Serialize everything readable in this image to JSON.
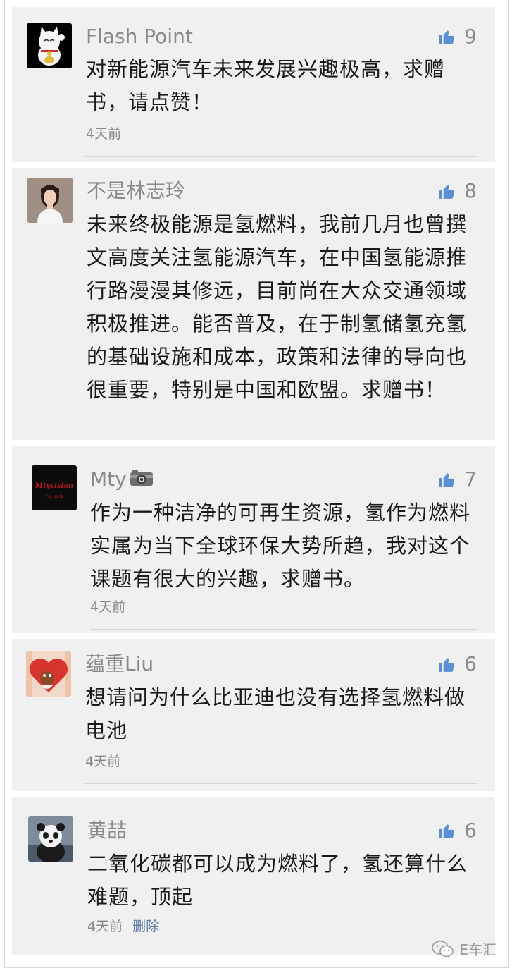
{
  "comments": [
    {
      "name": "Flash Point",
      "likes": "9",
      "content": "对新能源汽车未来发展兴趣极高，求赠书，请点赞！",
      "time": "4天前",
      "avatar_icon": "lucky-cat-avatar"
    },
    {
      "name": "不是林志玲",
      "likes": "8",
      "content": "未来终极能源是氢燃料，我前几月也曾撰文高度关注氢能源汽车，在中国氢能源推行路漫漫其修远，目前尚在大众交通领域积极推进。能否普及，在于制氢储氢充氢的基础设施和成本，政策和法律的导向也很重要，特别是中国和欧盟。求赠书！",
      "avatar_icon": "woman-portrait-avatar"
    },
    {
      "name": "Mty",
      "name_icon": "camera-icon",
      "likes": "7",
      "content": "作为一种洁净的可再生资源，氢作为燃料实属为当下全球环保大势所趋，我对这个课题有很大的兴趣，求赠书。",
      "time": "4天前",
      "avatar_text": "Mtyvision",
      "avatar_subtext": "I'm back",
      "avatar_icon": "dark-logo-avatar"
    },
    {
      "name": "蕴重Liu",
      "likes": "6",
      "content": "想请问为什么比亚迪也没有选择氢燃料做电池",
      "time": "4天前",
      "avatar_icon": "heart-cartoon-avatar"
    },
    {
      "name": "黄喆",
      "likes": "6",
      "content": "二氧化碳都可以成为燃料了，氢还算什么难题，顶起",
      "time": "4天前",
      "delete_label": "删除",
      "avatar_icon": "panda-avatar"
    }
  ],
  "watermark": {
    "text": "E车汇",
    "icon": "wechat-icon"
  },
  "colors": {
    "card_bg": "#f0f0f0",
    "name": "#8a8a8a",
    "content": "#1a1a1a",
    "thumb": "#5b8fd4",
    "delete_link": "#5b79a8"
  }
}
